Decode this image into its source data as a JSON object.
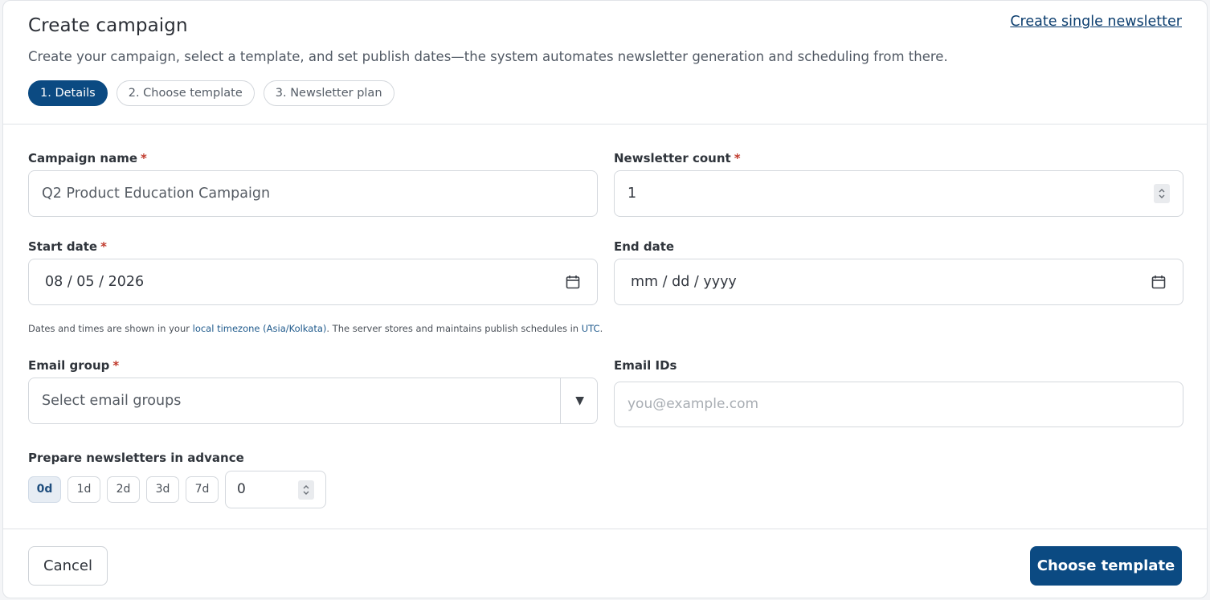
{
  "header": {
    "title": "Create campaign",
    "subtitle": "Create your campaign, select a template, and set publish dates—the system automates newsletter generation and scheduling from there.",
    "single_link": "Create single newsletter"
  },
  "steps": [
    {
      "label": "1. Details",
      "active": true
    },
    {
      "label": "2. Choose template",
      "active": false
    },
    {
      "label": "3. Newsletter plan",
      "active": false
    }
  ],
  "form": {
    "campaign_name": {
      "label": "Campaign name",
      "required": "*",
      "value": "Q2 Product Education Campaign"
    },
    "newsletter_count": {
      "label": "Newsletter count",
      "required": "*",
      "value": "1"
    },
    "start_date": {
      "label": "Start date",
      "required": "*",
      "value": "08 / 05 / 2026"
    },
    "end_date": {
      "label": "End date",
      "value": "mm / dd / yyyy"
    },
    "hint": {
      "prefix": "Dates and times are shown in your ",
      "timezone": "local timezone (Asia/Kolkata)",
      "middle": ". The server stores and maintains publish schedules in ",
      "utc": "UTC",
      "suffix": "."
    },
    "email_group": {
      "label": "Email group",
      "required": "*",
      "placeholder": "Select email groups"
    },
    "email_ids": {
      "label": "Email IDs",
      "placeholder": "you@example.com"
    },
    "advance": {
      "label": "Prepare newsletters in advance",
      "chips": [
        "0d",
        "1d",
        "2d",
        "3d",
        "7d"
      ],
      "selected": "0d",
      "value": "0"
    }
  },
  "footer": {
    "cancel": "Cancel",
    "next": "Choose template"
  },
  "colors": {
    "primary": "#0b4a82",
    "link": "#0b3d6e",
    "required": "#c0392b"
  }
}
